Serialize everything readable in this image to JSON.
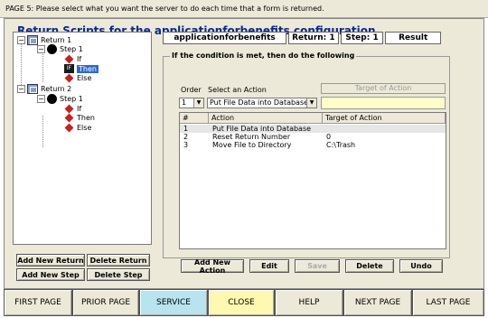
{
  "page_title": "PAGE 5: Please select what you want the server to do each time that a form is returned.",
  "heading": "Return Scripts for the applicationforbenefits configuration",
  "tree": {
    "return1": "Return 1",
    "step1a": "Step 1",
    "if1": "If",
    "then1": "Then",
    "else1": "Else",
    "return2": "Return 2",
    "step1b": "Step 1",
    "if2": "If",
    "then2": "Then",
    "else2": "Else",
    "expander_symbol": "−",
    "then_icon_glyph": "IF"
  },
  "tree_buttons": {
    "add_return": "Add New Return",
    "delete_return": "Delete Return",
    "add_step": "Add New Step",
    "delete_step": "Delete Step"
  },
  "header": {
    "config": "applicationforbenefits",
    "return": "Return: 1",
    "step": "Step: 1",
    "result": "Result"
  },
  "condition": {
    "group_title": "If the condition is met, then do the following",
    "order_label": "Order",
    "select_action_label": "Select an Action",
    "order_value": "1",
    "action_value": "Put File Data into Database",
    "target_header": "Target of Action",
    "target_value": "",
    "arrow_glyph": "▼"
  },
  "table": {
    "columns": [
      "#",
      "Action",
      "Target of Action"
    ],
    "rows": [
      {
        "num": "1",
        "action": "Put File Data into Database",
        "target": ""
      },
      {
        "num": "2",
        "action": "Reset Return Number",
        "target": "0"
      },
      {
        "num": "3",
        "action": "Move File to Directory",
        "target": "C:\\Trash"
      }
    ]
  },
  "action_buttons": {
    "add": "Add New Action",
    "edit": "Edit",
    "save": "Save",
    "delete": "Delete",
    "undo": "Undo"
  },
  "nav": {
    "first": "FIRST PAGE",
    "prior": "PRIOR PAGE",
    "service": "SERVICE",
    "close": "CLOSE",
    "help": "HELP",
    "next": "NEXT PAGE",
    "last": "LAST PAGE"
  },
  "colors": {
    "heading": "#0a2a8c",
    "service_bg": "#b8e4f0",
    "close_bg": "#fff8b0",
    "selected_node": "#316ac5",
    "target_input_bg": "#fffec8"
  }
}
